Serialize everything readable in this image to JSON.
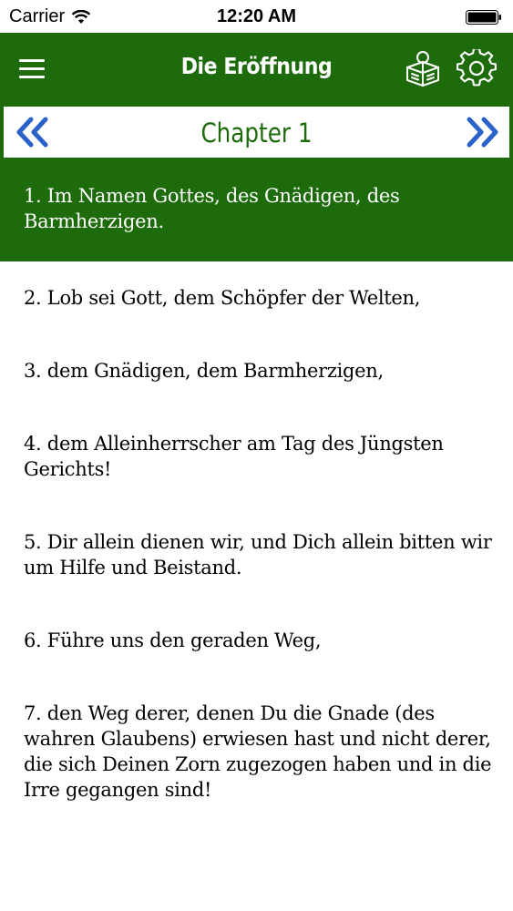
{
  "status_bar": {
    "carrier": "Carrier",
    "time": "12:20 AM"
  },
  "nav": {
    "title": "Die Eröffnung",
    "menu_icon": "hamburger-menu-icon",
    "book_icon": "book-reader-icon",
    "settings_icon": "gear-icon"
  },
  "chapter": {
    "title": "Chapter 1",
    "prev_icon": "double-chevron-left-icon",
    "next_icon": "double-chevron-right-icon"
  },
  "verses": [
    {
      "text": "1. Im Namen Gottes, des Gnädigen, des Barmherzigen.",
      "selected": true
    },
    {
      "text": "2. Lob sei Gott, dem Schöpfer der Welten,",
      "selected": false
    },
    {
      "text": "3. dem Gnädigen, dem Barmherzigen,",
      "selected": false
    },
    {
      "text": "4. dem Alleinherrscher am Tag des Jüngsten Gerichts!",
      "selected": false
    },
    {
      "text": "5. Dir allein dienen wir, und Dich allein bitten wir um Hilfe und Beistand.",
      "selected": false
    },
    {
      "text": "6. Führe uns den geraden Weg,",
      "selected": false
    },
    {
      "text": "7. den Weg derer, denen Du die Gnade (des wahren Glaubens) erwiesen hast und nicht derer, die sich Deinen Zorn zugezogen haben und in die Irre gegangen sind!",
      "selected": false
    }
  ],
  "colors": {
    "accent": "#1e6b0c",
    "background": "#ffffff",
    "text": "#000000",
    "link_blue": "#2a62c9"
  }
}
